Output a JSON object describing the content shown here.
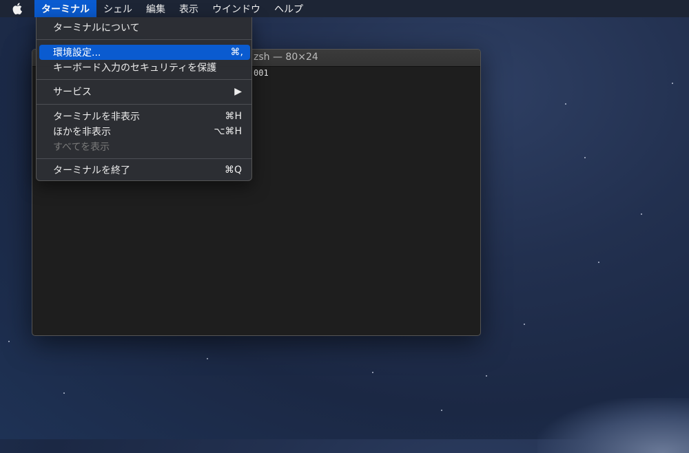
{
  "menubar": {
    "items": [
      {
        "label": "ターミナル",
        "active": true
      },
      {
        "label": "シェル"
      },
      {
        "label": "編集"
      },
      {
        "label": "表示"
      },
      {
        "label": "ウインドウ"
      },
      {
        "label": "ヘルプ"
      }
    ]
  },
  "terminal": {
    "title": "zsh — 80×24",
    "visible_text": "001"
  },
  "menu": {
    "items": [
      {
        "label": "ターミナルについて",
        "shortcut": ""
      },
      {
        "label": "環境設定...",
        "shortcut": "⌘,"
      },
      {
        "label": "キーボード入力のセキュリティを保護",
        "shortcut": ""
      },
      {
        "label": "サービス",
        "shortcut": "▶"
      },
      {
        "label": "ターミナルを非表示",
        "shortcut": "⌘H"
      },
      {
        "label": "ほかを非表示",
        "shortcut": "⌥⌘H"
      },
      {
        "label": "すべてを表示",
        "shortcut": ""
      },
      {
        "label": "ターミナルを終了",
        "shortcut": "⌘Q"
      }
    ]
  },
  "colors": {
    "accent": "#0a5bd0",
    "menubar": "#1d2535",
    "menu_bg": "#2c2e34",
    "terminal_bg": "#1e1e1e"
  }
}
